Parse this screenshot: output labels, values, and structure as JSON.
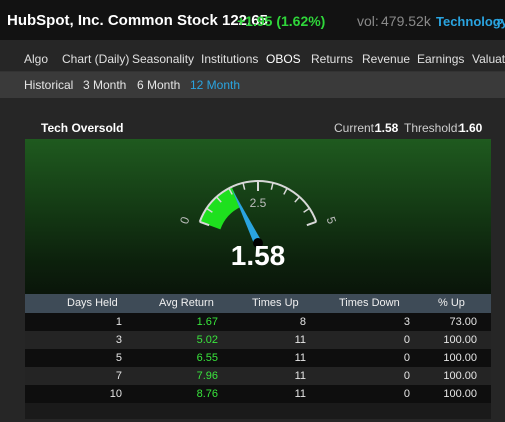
{
  "header": {
    "title": "HubSpot, Inc. Common Stock 122.65",
    "change": "+1.95 (1.62%)",
    "vol_label": "vol:",
    "vol_value": "479.52k",
    "sector": "Technology",
    "sector_more": "»",
    "colors": {
      "up": "#2fd63a",
      "link": "#2aa4e0"
    }
  },
  "nav": {
    "tabs": [
      "Algo",
      "Chart (Daily)",
      "Seasonality",
      "Institutions",
      "OBOS",
      "Returns",
      "Revenue",
      "Earnings",
      "Valuation"
    ],
    "active": "OBOS"
  },
  "subnav": {
    "tabs": [
      "Historical",
      "3 Month",
      "6 Month",
      "12 Month"
    ],
    "active": "12 Month"
  },
  "panel": {
    "title": "Tech Oversold",
    "current_label": "Current:",
    "current_value": "1.58",
    "threshold_label": "Threshold:",
    "threshold_value": "1.60"
  },
  "gauge": {
    "min_label": "0",
    "mid_label": "2.5",
    "max_label": "5",
    "value_text": "1.58",
    "min": 0,
    "max": 5,
    "value": 1.58,
    "threshold": 1.6,
    "colors": {
      "zone": "#1ee01e",
      "needle": "#2aa4e0",
      "dial": "#d8d8d8"
    }
  },
  "table": {
    "headers": [
      "Days Held",
      "Avg Return",
      "Times Up",
      "Times Down",
      "% Up"
    ],
    "rows": [
      [
        "1",
        "1.67",
        "8",
        "3",
        "73.00"
      ],
      [
        "3",
        "5.02",
        "11",
        "0",
        "100.00"
      ],
      [
        "5",
        "6.55",
        "11",
        "0",
        "100.00"
      ],
      [
        "7",
        "7.96",
        "11",
        "0",
        "100.00"
      ],
      [
        "10",
        "8.76",
        "11",
        "0",
        "100.00"
      ]
    ]
  }
}
